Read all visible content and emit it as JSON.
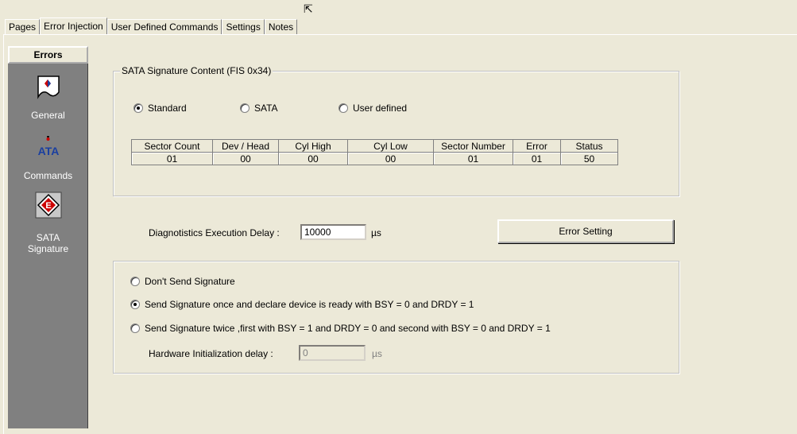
{
  "tabs": [
    {
      "label": "Pages"
    },
    {
      "label": "Error Injection"
    },
    {
      "label": "User Defined Commands"
    },
    {
      "label": "Settings"
    },
    {
      "label": "Notes"
    }
  ],
  "sidebar": {
    "header": "Errors",
    "items": [
      {
        "label": "General",
        "icon": "general-icon"
      },
      {
        "label": "Commands",
        "icon": "ata-icon",
        "icon_text": "ATA"
      },
      {
        "label": "SATA\nSignature",
        "label_line1": "SATA",
        "label_line2": "Signature",
        "icon": "sata-signature-icon",
        "icon_text": "E"
      }
    ]
  },
  "signature_group": {
    "legend": "SATA Signature Content (FIS 0x34)",
    "radios": [
      {
        "label": "Standard",
        "checked": true
      },
      {
        "label": "SATA",
        "checked": false
      },
      {
        "label": "User defined",
        "checked": false
      }
    ],
    "table": {
      "headers": [
        "Sector Count",
        "Dev / Head",
        "Cyl High",
        "Cyl Low",
        "Sector Number",
        "Error",
        "Status"
      ],
      "values": [
        "01",
        "00",
        "00",
        "00",
        "01",
        "01",
        "50"
      ]
    }
  },
  "diagnostics": {
    "label": "Diagnotistics Execution Delay :",
    "value": "10000",
    "unit": "µs"
  },
  "error_setting_button": "Error Setting",
  "send_group": {
    "radios": [
      {
        "label": "Don't Send Signature",
        "checked": false
      },
      {
        "label": "Send Signature once and declare device is ready with BSY = 0 and DRDY = 1",
        "checked": true
      },
      {
        "label": "Send Signature twice ,first with BSY = 1 and DRDY = 0 and second with BSY = 0 and DRDY = 1",
        "checked": false
      }
    ],
    "hw_init": {
      "label": "Hardware Initialization delay :",
      "value": "0",
      "unit": "µs"
    }
  }
}
